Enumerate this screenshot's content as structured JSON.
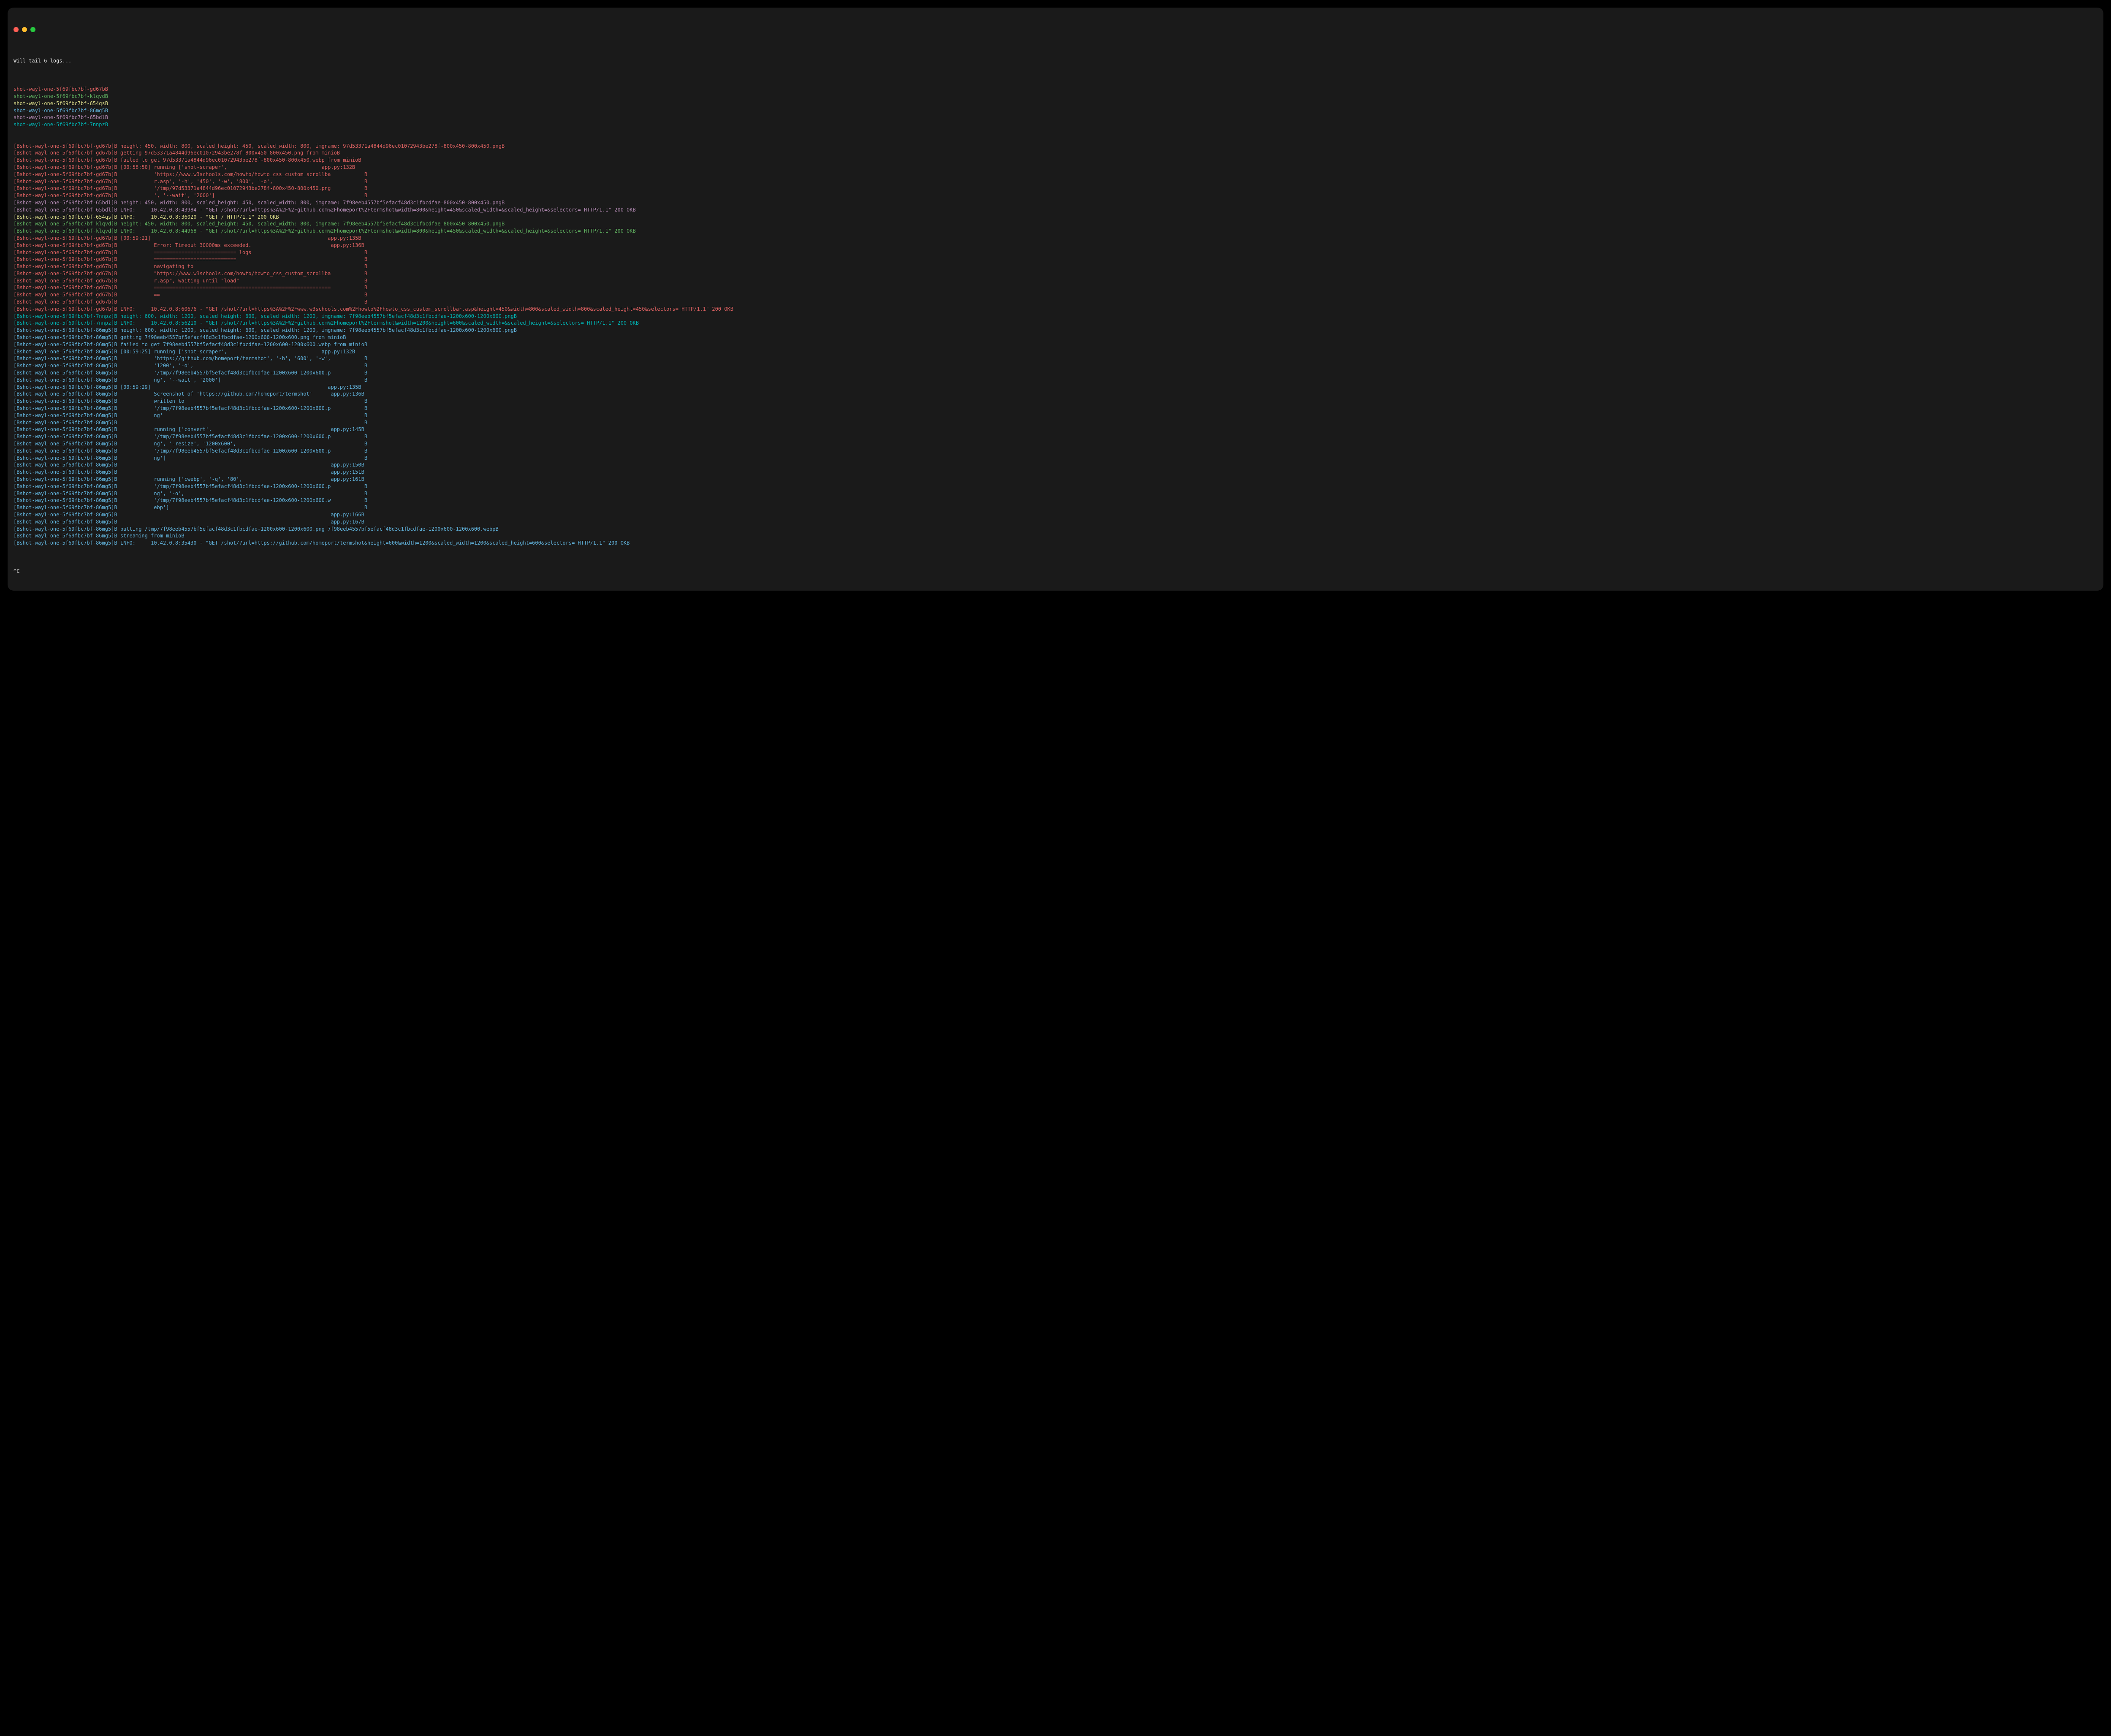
{
  "header": "Will tail 6 logs...",
  "footer": "^C",
  "palette": {
    "gd67b": "#d75f5f",
    "klqvd": "#5faf5f",
    "654qs": "#d7d787",
    "86mg5": "#5fafd7",
    "65bdl": "#af87af",
    "7nnpz": "#00afaf",
    "white": "#e0e0e0"
  },
  "pods": [
    {
      "id": "gd67b",
      "text": "shot-wayl-one-5f69fbc7bf-gd67bB"
    },
    {
      "id": "klqvd",
      "text": "shot-wayl-one-5f69fbc7bf-klqvdB"
    },
    {
      "id": "654qs",
      "text": "shot-wayl-one-5f69fbc7bf-654qsB"
    },
    {
      "id": "86mg5",
      "text": "shot-wayl-one-5f69fbc7bf-86mg5B"
    },
    {
      "id": "65bdl",
      "text": "shot-wayl-one-5f69fbc7bf-65bdlB"
    },
    {
      "id": "7nnpz",
      "text": "shot-wayl-one-5f69fbc7bf-7nnpzB"
    }
  ],
  "lines": [
    {
      "p": "gd67b",
      "t": "[Bshot-wayl-one-5f69fbc7bf-gd67b]B height: 450, width: 800, scaled_height: 450, scaled_width: 800, imgname: 97d53371a4844d96ec01072943be278f-800x450-800x450.pngB"
    },
    {
      "p": "gd67b",
      "t": "[Bshot-wayl-one-5f69fbc7bf-gd67b]B getting 97d53371a4844d96ec01072943be278f-800x450-800x450.png from minioB"
    },
    {
      "p": "gd67b",
      "t": "[Bshot-wayl-one-5f69fbc7bf-gd67b]B failed to get 97d53371a4844d96ec01072943be278f-800x450-800x450.webp from minioB"
    },
    {
      "p": "gd67b",
      "t": "[Bshot-wayl-one-5f69fbc7bf-gd67b]B [00:58:50] running ['shot-scraper',                               app.py:132B"
    },
    {
      "p": "gd67b",
      "t": "[Bshot-wayl-one-5f69fbc7bf-gd67b]B            'https://www.w3schools.com/howto/howto_css_custom_scrollba           B"
    },
    {
      "p": "gd67b",
      "t": "[Bshot-wayl-one-5f69fbc7bf-gd67b]B            r.asp', '-h', '450', '-w', '800', '-o',                              B"
    },
    {
      "p": "gd67b",
      "t": "[Bshot-wayl-one-5f69fbc7bf-gd67b]B            '/tmp/97d53371a4844d96ec01072943be278f-800x450-800x450.png           B"
    },
    {
      "p": "gd67b",
      "t": "[Bshot-wayl-one-5f69fbc7bf-gd67b]B            ', '--wait', '2000']                                                 B"
    },
    {
      "p": "65bdl",
      "t": "[Bshot-wayl-one-5f69fbc7bf-65bdl]B height: 450, width: 800, scaled_height: 450, scaled_width: 800, imgname: 7f98eeb4557bf5efacf48d3c1fbcdfae-800x450-800x450.pngB"
    },
    {
      "p": "65bdl",
      "t": "[Bshot-wayl-one-5f69fbc7bf-65bdl]B INFO:     10.42.0.8:43984 - \"GET /shot/?url=https%3A%2F%2Fgithub.com%2Fhomeport%2Ftermshot&width=800&height=450&scaled_width=&scaled_height=&selectors= HTTP/1.1\" 200 OKB"
    },
    {
      "p": "654qs",
      "t": "[Bshot-wayl-one-5f69fbc7bf-654qs]B INFO:     10.42.0.8:36020 - \"GET / HTTP/1.1\" 200 OKB"
    },
    {
      "p": "klqvd",
      "t": "[Bshot-wayl-one-5f69fbc7bf-klqvd]B height: 450, width: 800, scaled_height: 450, scaled_width: 800, imgname: 7f98eeb4557bf5efacf48d3c1fbcdfae-800x450-800x450.pngB"
    },
    {
      "p": "klqvd",
      "t": "[Bshot-wayl-one-5f69fbc7bf-klqvd]B INFO:     10.42.0.8:44968 - \"GET /shot/?url=https%3A%2F%2Fgithub.com%2Fhomeport%2Ftermshot&width=800&height=450&scaled_width=&scaled_height=&selectors= HTTP/1.1\" 200 OKB"
    },
    {
      "p": "gd67b",
      "t": "[Bshot-wayl-one-5f69fbc7bf-gd67b]B [00:59:21]                                                          app.py:135B"
    },
    {
      "p": "gd67b",
      "t": "[Bshot-wayl-one-5f69fbc7bf-gd67b]B            Error: Timeout 30000ms exceeded.                          app.py:136B"
    },
    {
      "p": "gd67b",
      "t": "[Bshot-wayl-one-5f69fbc7bf-gd67b]B            =========================== logs                                     B"
    },
    {
      "p": "gd67b",
      "t": "[Bshot-wayl-one-5f69fbc7bf-gd67b]B            ===========================                                          B"
    },
    {
      "p": "gd67b",
      "t": "[Bshot-wayl-one-5f69fbc7bf-gd67b]B            navigating to                                                        B"
    },
    {
      "p": "gd67b",
      "t": "[Bshot-wayl-one-5f69fbc7bf-gd67b]B            \"https://www.w3schools.com/howto/howto_css_custom_scrollba           B"
    },
    {
      "p": "gd67b",
      "t": "[Bshot-wayl-one-5f69fbc7bf-gd67b]B            r.asp\", waiting until \"load\"                                         B"
    },
    {
      "p": "gd67b",
      "t": "[Bshot-wayl-one-5f69fbc7bf-gd67b]B            ==========================================================           B"
    },
    {
      "p": "gd67b",
      "t": "[Bshot-wayl-one-5f69fbc7bf-gd67b]B            ==                                                                   B"
    },
    {
      "p": "gd67b",
      "t": "[Bshot-wayl-one-5f69fbc7bf-gd67b]B                                                                                 B"
    },
    {
      "p": "gd67b",
      "t": "[Bshot-wayl-one-5f69fbc7bf-gd67b]B INFO:     10.42.0.8:60676 - \"GET /shot/?url=https%3A%2F%2Fwww.w3schools.com%2Fhowto%2Fhowto_css_custom_scrollbar.asp&height=450&width=800&scaled_width=800&scaled_height=450&selectors= HTTP/1.1\" 200 OKB"
    },
    {
      "p": "7nnpz",
      "t": "[Bshot-wayl-one-5f69fbc7bf-7nnpz]B height: 600, width: 1200, scaled_height: 600, scaled_width: 1200, imgname: 7f98eeb4557bf5efacf48d3c1fbcdfae-1200x600-1200x600.pngB"
    },
    {
      "p": "7nnpz",
      "t": "[Bshot-wayl-one-5f69fbc7bf-7nnpz]B INFO:     10.42.0.8:56210 - \"GET /shot/?url=https%3A%2F%2Fgithub.com%2Fhomeport%2Ftermshot&width=1200&height=600&scaled_width=&scaled_height=&selectors= HTTP/1.1\" 200 OKB"
    },
    {
      "p": "86mg5",
      "t": "[Bshot-wayl-one-5f69fbc7bf-86mg5]B height: 600, width: 1200, scaled_height: 600, scaled_width: 1200, imgname: 7f98eeb4557bf5efacf48d3c1fbcdfae-1200x600-1200x600.pngB"
    },
    {
      "p": "86mg5",
      "t": "[Bshot-wayl-one-5f69fbc7bf-86mg5]B getting 7f98eeb4557bf5efacf48d3c1fbcdfae-1200x600-1200x600.png from minioB"
    },
    {
      "p": "86mg5",
      "t": "[Bshot-wayl-one-5f69fbc7bf-86mg5]B failed to get 7f98eeb4557bf5efacf48d3c1fbcdfae-1200x600-1200x600.webp from minioB"
    },
    {
      "p": "86mg5",
      "t": "[Bshot-wayl-one-5f69fbc7bf-86mg5]B [00:59:25] running ['shot-scraper',                               app.py:132B"
    },
    {
      "p": "86mg5",
      "t": "[Bshot-wayl-one-5f69fbc7bf-86mg5]B            'https://github.com/homeport/termshot', '-h', '600', '-w',           B"
    },
    {
      "p": "86mg5",
      "t": "[Bshot-wayl-one-5f69fbc7bf-86mg5]B            '1200', '-o',                                                        B"
    },
    {
      "p": "86mg5",
      "t": "[Bshot-wayl-one-5f69fbc7bf-86mg5]B            '/tmp/7f98eeb4557bf5efacf48d3c1fbcdfae-1200x600-1200x600.p           B"
    },
    {
      "p": "86mg5",
      "t": "[Bshot-wayl-one-5f69fbc7bf-86mg5]B            ng', '--wait', '2000']                                               B"
    },
    {
      "p": "86mg5",
      "t": "[Bshot-wayl-one-5f69fbc7bf-86mg5]B [00:59:29]                                                          app.py:135B"
    },
    {
      "p": "86mg5",
      "t": "[Bshot-wayl-one-5f69fbc7bf-86mg5]B            Screenshot of 'https://github.com/homeport/termshot'      app.py:136B"
    },
    {
      "p": "86mg5",
      "t": "[Bshot-wayl-one-5f69fbc7bf-86mg5]B            written to                                                           B"
    },
    {
      "p": "86mg5",
      "t": "[Bshot-wayl-one-5f69fbc7bf-86mg5]B            '/tmp/7f98eeb4557bf5efacf48d3c1fbcdfae-1200x600-1200x600.p           B"
    },
    {
      "p": "86mg5",
      "t": "[Bshot-wayl-one-5f69fbc7bf-86mg5]B            ng'                                                                  B"
    },
    {
      "p": "86mg5",
      "t": "[Bshot-wayl-one-5f69fbc7bf-86mg5]B                                                                                 B"
    },
    {
      "p": "86mg5",
      "t": "[Bshot-wayl-one-5f69fbc7bf-86mg5]B            running ['convert',                                       app.py:145B"
    },
    {
      "p": "86mg5",
      "t": "[Bshot-wayl-one-5f69fbc7bf-86mg5]B            '/tmp/7f98eeb4557bf5efacf48d3c1fbcdfae-1200x600-1200x600.p           B"
    },
    {
      "p": "86mg5",
      "t": "[Bshot-wayl-one-5f69fbc7bf-86mg5]B            ng', '-resize', '1200x600',                                          B"
    },
    {
      "p": "86mg5",
      "t": "[Bshot-wayl-one-5f69fbc7bf-86mg5]B            '/tmp/7f98eeb4557bf5efacf48d3c1fbcdfae-1200x600-1200x600.p           B"
    },
    {
      "p": "86mg5",
      "t": "[Bshot-wayl-one-5f69fbc7bf-86mg5]B            ng']                                                                 B"
    },
    {
      "p": "86mg5",
      "t": "[Bshot-wayl-one-5f69fbc7bf-86mg5]B                                                                      app.py:150B"
    },
    {
      "p": "86mg5",
      "t": "[Bshot-wayl-one-5f69fbc7bf-86mg5]B                                                                      app.py:151B"
    },
    {
      "p": "86mg5",
      "t": "[Bshot-wayl-one-5f69fbc7bf-86mg5]B            running ['cwebp', '-q', '80',                             app.py:161B"
    },
    {
      "p": "86mg5",
      "t": "[Bshot-wayl-one-5f69fbc7bf-86mg5]B            '/tmp/7f98eeb4557bf5efacf48d3c1fbcdfae-1200x600-1200x600.p           B"
    },
    {
      "p": "86mg5",
      "t": "[Bshot-wayl-one-5f69fbc7bf-86mg5]B            ng', '-o',                                                           B"
    },
    {
      "p": "86mg5",
      "t": "[Bshot-wayl-one-5f69fbc7bf-86mg5]B            '/tmp/7f98eeb4557bf5efacf48d3c1fbcdfae-1200x600-1200x600.w           B"
    },
    {
      "p": "86mg5",
      "t": "[Bshot-wayl-one-5f69fbc7bf-86mg5]B            ebp']                                                                B"
    },
    {
      "p": "86mg5",
      "t": "[Bshot-wayl-one-5f69fbc7bf-86mg5]B                                                                      app.py:166B"
    },
    {
      "p": "86mg5",
      "t": "[Bshot-wayl-one-5f69fbc7bf-86mg5]B                                                                      app.py:167B"
    },
    {
      "p": "86mg5",
      "t": "[Bshot-wayl-one-5f69fbc7bf-86mg5]B putting /tmp/7f98eeb4557bf5efacf48d3c1fbcdfae-1200x600-1200x600.png 7f98eeb4557bf5efacf48d3c1fbcdfae-1200x600-1200x600.webpB"
    },
    {
      "p": "86mg5",
      "t": "[Bshot-wayl-one-5f69fbc7bf-86mg5]B streaming from minioB"
    },
    {
      "p": "86mg5",
      "t": "[Bshot-wayl-one-5f69fbc7bf-86mg5]B INFO:     10.42.0.8:35430 - \"GET /shot/?url=https://github.com/homeport/termshot&height=600&width=1200&scaled_width=1200&scaled_height=600&selectors= HTTP/1.1\" 200 OKB"
    }
  ]
}
